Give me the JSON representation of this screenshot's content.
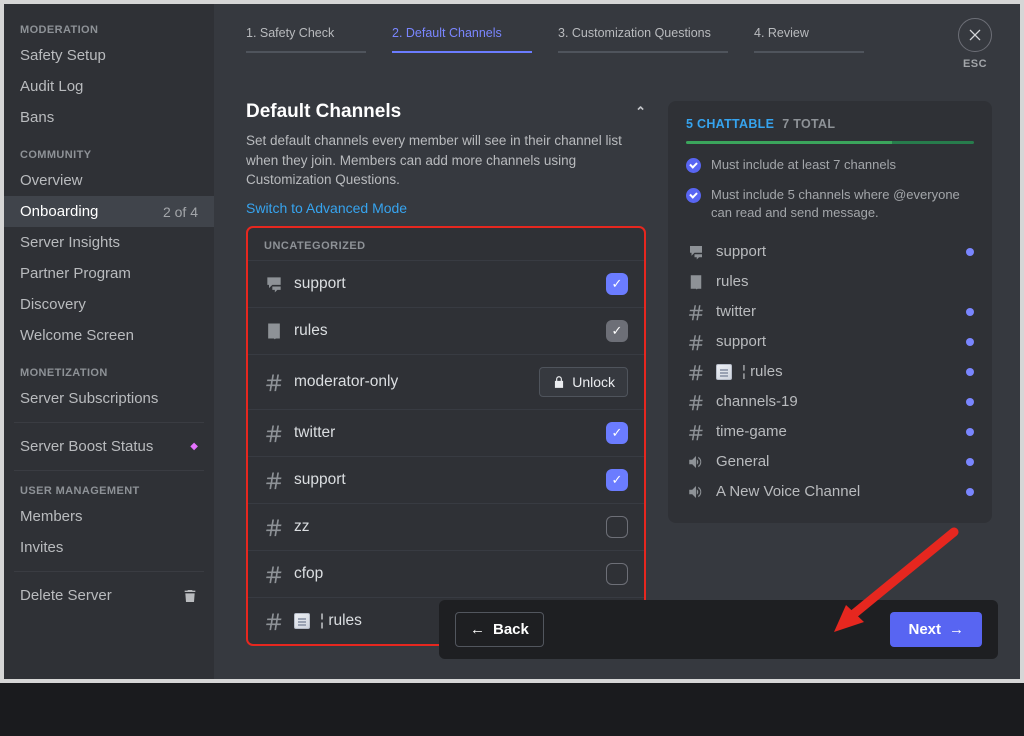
{
  "close": {
    "label": "ESC"
  },
  "sidebar": {
    "groups": [
      {
        "title": "MODERATION",
        "items": [
          {
            "label": "Safety Setup"
          },
          {
            "label": "Audit Log"
          },
          {
            "label": "Bans"
          }
        ]
      },
      {
        "title": "COMMUNITY",
        "items": [
          {
            "label": "Overview"
          },
          {
            "label": "Onboarding",
            "badge": "2 of 4",
            "active": true
          },
          {
            "label": "Server Insights"
          },
          {
            "label": "Partner Program"
          },
          {
            "label": "Discovery"
          },
          {
            "label": "Welcome Screen"
          }
        ]
      },
      {
        "title": "MONETIZATION",
        "items": [
          {
            "label": "Server Subscriptions"
          }
        ]
      },
      {
        "title": "",
        "items": [
          {
            "label": "Server Boost Status",
            "gem": true
          }
        ]
      },
      {
        "title": "USER MANAGEMENT",
        "items": [
          {
            "label": "Members"
          },
          {
            "label": "Invites"
          }
        ]
      },
      {
        "title": "",
        "items": [
          {
            "label": "Delete Server",
            "trash": true
          }
        ]
      }
    ]
  },
  "stepper": [
    {
      "label": "1. Safety Check"
    },
    {
      "label": "2. Default Channels",
      "active": true
    },
    {
      "label": "3. Customization Questions"
    },
    {
      "label": "4. Review"
    }
  ],
  "header": {
    "title": "Default Channels",
    "subtitle": "Set default channels every member will see in their channel list when they join. Members can add more channels using Customization Questions.",
    "switch_link": "Switch to Advanced Mode"
  },
  "panel": {
    "category": "UNCATEGORIZED",
    "channels": [
      {
        "icon": "thread",
        "name": "support",
        "state": "on"
      },
      {
        "icon": "rules",
        "name": "rules",
        "state": "on-grey"
      },
      {
        "icon": "hash",
        "name": "moderator-only",
        "state": "unlock",
        "unlock_label": "Unlock"
      },
      {
        "icon": "hash",
        "name": "twitter",
        "state": "on"
      },
      {
        "icon": "hash",
        "name": "support",
        "state": "on"
      },
      {
        "icon": "hash",
        "name": "zz",
        "state": "off"
      },
      {
        "icon": "hash",
        "name": "cfop",
        "state": "off"
      },
      {
        "icon": "hash-doc",
        "name": "¦ rules",
        "state": "on"
      }
    ]
  },
  "summary": {
    "chattable": "5 CHATTABLE",
    "total": "7 TOTAL",
    "reqs": [
      "Must include at least 7 channels",
      "Must include 5 channels where @everyone can read and send message."
    ],
    "list": [
      {
        "icon": "thread",
        "name": "support",
        "dot": true
      },
      {
        "icon": "rules",
        "name": "rules"
      },
      {
        "icon": "hash",
        "name": "twitter",
        "dot": true
      },
      {
        "icon": "hash",
        "name": "support",
        "dot": true
      },
      {
        "icon": "hash-doc",
        "name": "¦ rules",
        "dot": true
      },
      {
        "icon": "hash",
        "name": "channels-19",
        "dot": true
      },
      {
        "icon": "hash",
        "name": "time-game",
        "dot": true
      },
      {
        "icon": "voice",
        "name": "General",
        "dot": true
      },
      {
        "icon": "voice",
        "name": "A New Voice Channel",
        "dot": true
      }
    ]
  },
  "footer": {
    "back": "Back",
    "next": "Next"
  }
}
